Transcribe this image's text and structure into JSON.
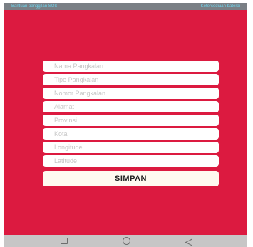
{
  "status_bar": {
    "left_text": "Bantuan panggilan SOS",
    "right_text": "Ketersediaan baterai"
  },
  "form": {
    "fields": [
      {
        "placeholder": "Nama Pangkalan"
      },
      {
        "placeholder": "Tipe Pangkalan"
      },
      {
        "placeholder": "Nomor Pangkalan"
      },
      {
        "placeholder": "Alamat"
      },
      {
        "placeholder": "Provinsi"
      },
      {
        "placeholder": "Kota"
      },
      {
        "placeholder": "Longitude"
      },
      {
        "placeholder": "Latitude"
      }
    ],
    "submit_label": "SIMPAN"
  },
  "colors": {
    "background": "#dc1a40",
    "field": "#ffffff",
    "button": "#fffaf0",
    "status_bar": "#7a7f85",
    "nav_bar": "#c7c6c6"
  },
  "nav_bar": {
    "icons": [
      "recent-apps-icon",
      "home-icon",
      "back-icon"
    ]
  }
}
